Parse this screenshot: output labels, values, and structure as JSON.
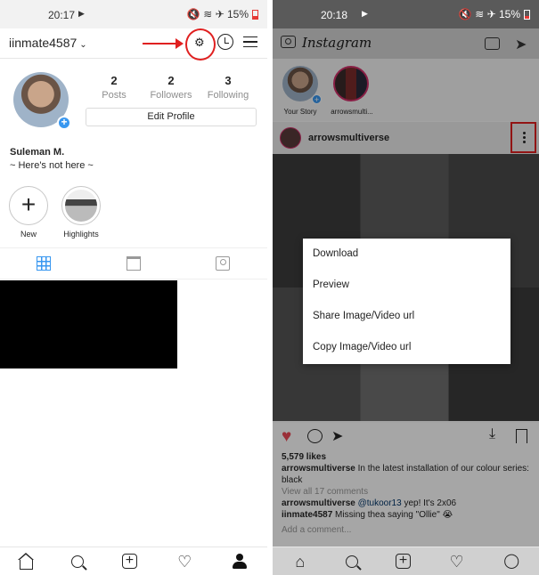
{
  "left": {
    "status": {
      "time": "20:17",
      "play": "▶",
      "icons": "🔇 ≋ ✈ 15%"
    },
    "header": {
      "username": "iinmate4587",
      "chevron": "⌄"
    },
    "stats": [
      {
        "num": "2",
        "label": "Posts"
      },
      {
        "num": "2",
        "label": "Followers"
      },
      {
        "num": "3",
        "label": "Following"
      }
    ],
    "edit_profile": "Edit Profile",
    "full_name": "Suleman M.",
    "bio": "~ Here's not here ~",
    "stories": {
      "new_label": "New",
      "highlights_label": "Highlights"
    }
  },
  "right": {
    "status": {
      "time": "20:18",
      "play": "▶",
      "icons": "🔇 ≋ ✈ 15%"
    },
    "header": {
      "logo": "Instagram"
    },
    "stories": [
      {
        "label": "Your Story"
      },
      {
        "label": "arrowsmulti..."
      }
    ],
    "post": {
      "user": "arrowsmultiverse",
      "likes": "5,579 likes",
      "caption_user": "arrowsmultiverse",
      "caption_text": "In the latest installation of our colour series: black",
      "view_comments": "View all 17 comments",
      "comments": [
        {
          "user": "arrowsmultiverse",
          "mention": "@tukoor13",
          "text": " yep! It's 2x06"
        },
        {
          "user": "iinmate4587",
          "mention": "",
          "text": " Missing thea saying \"Ollie\" 😭"
        }
      ],
      "add_comment": "Add a comment..."
    },
    "context_menu": [
      "Download",
      "Preview",
      "Share Image/Video url",
      "Copy Image/Video url"
    ]
  },
  "colors": {
    "accent": "#3897f0",
    "annotation": "#e02020",
    "like": "#ed4956"
  },
  "icons": {
    "settings": "gear-icon",
    "history": "history-icon",
    "menu": "menu-icon",
    "grid": "grid-icon",
    "igtv": "igtv-icon",
    "tagged": "tagged-icon"
  }
}
